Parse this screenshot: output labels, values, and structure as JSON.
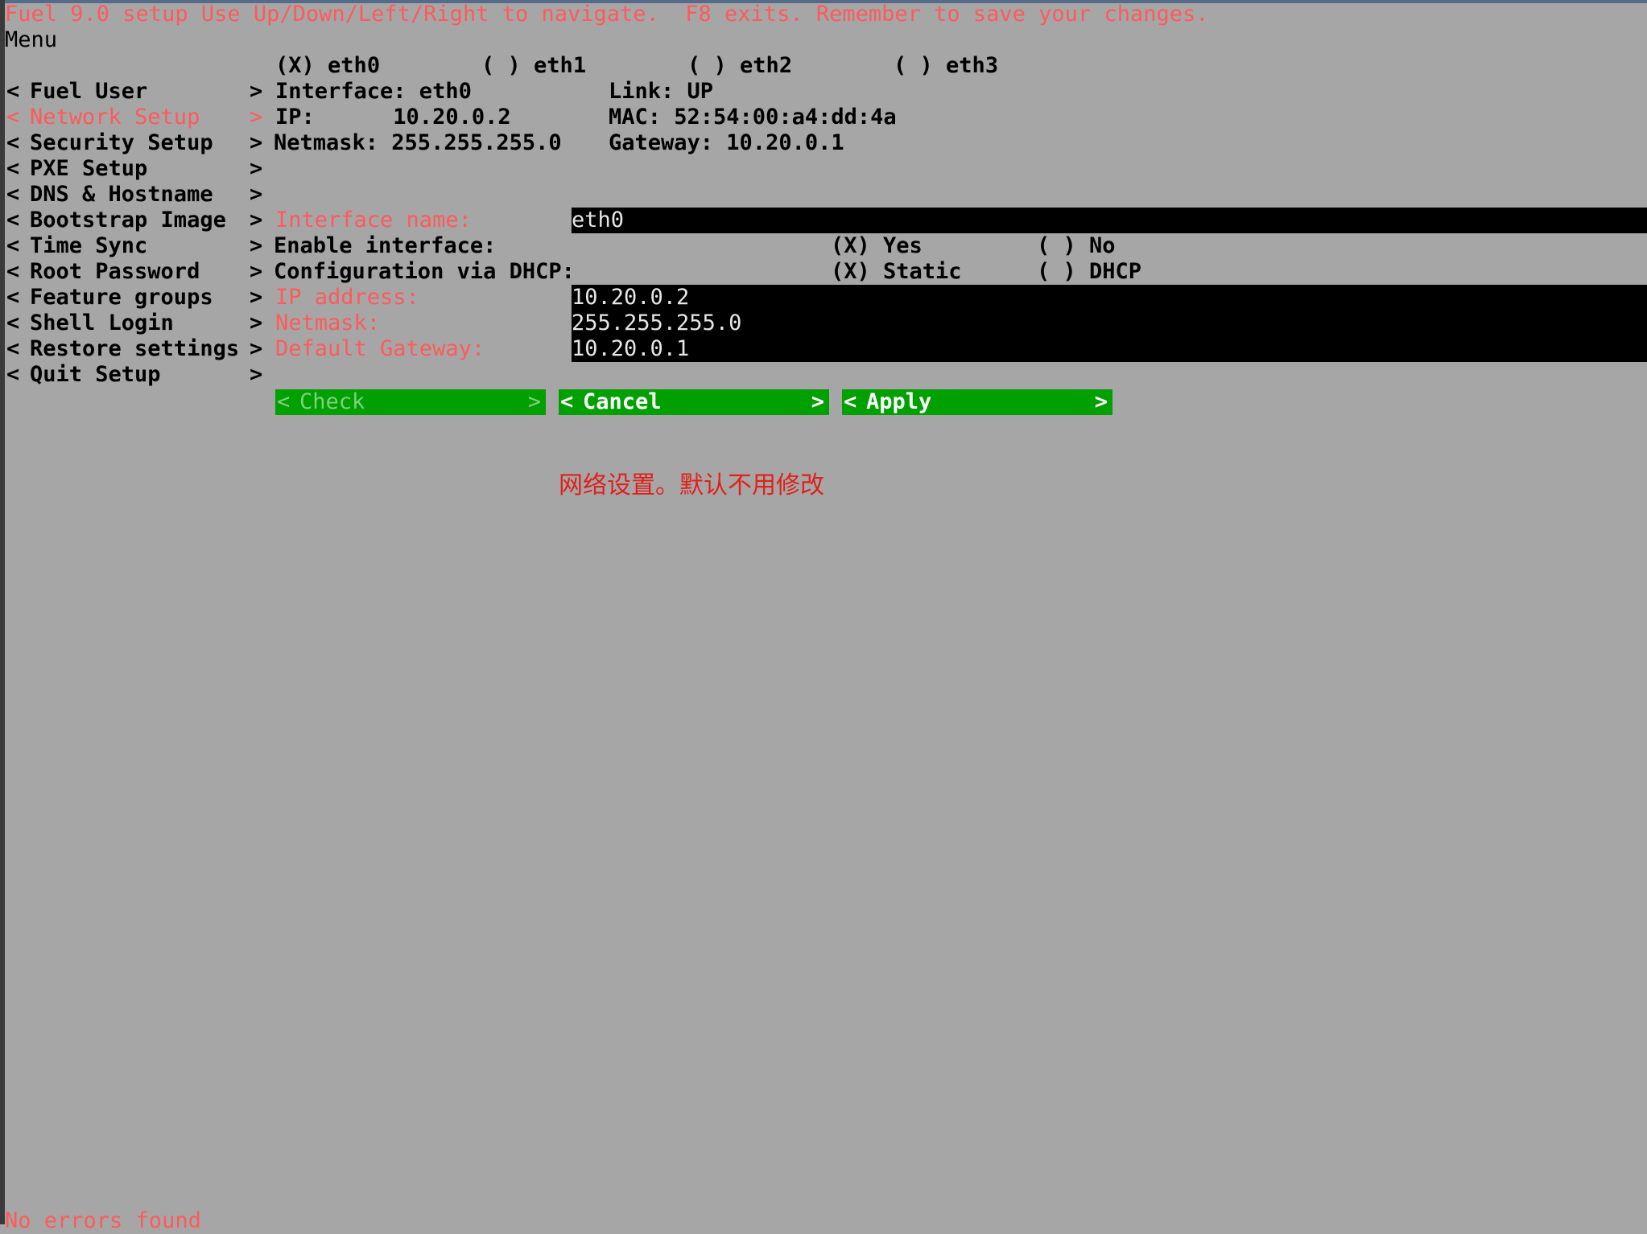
{
  "header": {
    "line": "Fuel 9.0 setup Use Up/Down/Left/Right to navigate.  F8 exits. Remember to save your changes.",
    "menu_title": "Menu"
  },
  "menu": {
    "items": [
      {
        "label": "Fuel User"
      },
      {
        "label": "Network Setup"
      },
      {
        "label": "Security Setup"
      },
      {
        "label": "PXE Setup"
      },
      {
        "label": "DNS & Hostname"
      },
      {
        "label": "Bootstrap Image"
      },
      {
        "label": "Time Sync"
      },
      {
        "label": "Root Password"
      },
      {
        "label": "Feature groups"
      },
      {
        "label": "Shell Login"
      },
      {
        "label": "Restore settings"
      },
      {
        "label": "Quit Setup"
      }
    ],
    "active": "Network Setup"
  },
  "interfaces": [
    {
      "mark": "(X)",
      "name": "eth0"
    },
    {
      "mark": "( )",
      "name": "eth1"
    },
    {
      "mark": "( )",
      "name": "eth2"
    },
    {
      "mark": "( )",
      "name": "eth3"
    }
  ],
  "info": {
    "interface": "Interface: eth0",
    "link": "Link: UP",
    "ip": "IP:      10.20.0.2",
    "mac": "MAC: 52:54:00:a4:dd:4a",
    "netmask": "Netmask: 255.255.255.0",
    "gateway": "Gateway: 10.20.0.1"
  },
  "form": {
    "interface_name_label": "Interface name:",
    "interface_name_value": "eth0",
    "enable_label": "Enable interface:",
    "enable_yes": "(X) Yes",
    "enable_no": "( ) No",
    "dhcp_label": "Configuration via DHCP:",
    "dhcp_static": "(X) Static",
    "dhcp_dhcp": "( ) DHCP",
    "ip_label": "IP address:",
    "ip_value": "10.20.0.2",
    "netmask_label": "Netmask:",
    "netmask_value": "255.255.255.0",
    "gateway_label": "Default Gateway:",
    "gateway_value": "10.20.0.1"
  },
  "buttons": {
    "check": "Check",
    "cancel": "Cancel",
    "apply": "Apply",
    "left": "<",
    "right": ">"
  },
  "annotation": "网络设置。默认不用修改",
  "status": "No errors found"
}
